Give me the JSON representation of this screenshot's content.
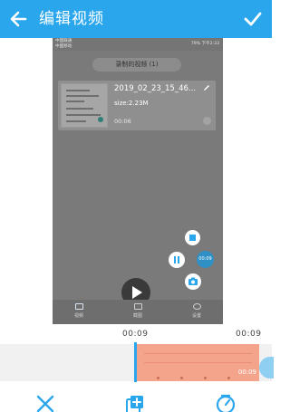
{
  "appbar": {
    "title": "编辑视频",
    "background": "#2aa6ec"
  },
  "preview": {
    "status_bar": {
      "carrier": "中国联通\n中国移动",
      "system": "79% 下午2:33"
    },
    "dropdown_label": "录制的视频 (1)",
    "video_item": {
      "filename": "2019_02_23_15_46...",
      "size": "size:2.23M",
      "duration": "00:06"
    },
    "floating_timer": "00:09",
    "bottom_tabs": [
      {
        "label": "视频",
        "icon": "video-icon"
      },
      {
        "label": "截图",
        "icon": "image-icon"
      },
      {
        "label": "设置",
        "icon": "settings-icon"
      }
    ]
  },
  "timeline": {
    "current_time": "00:09",
    "total_time": "00:09",
    "clip_time": "00:09",
    "clip_color": "#f4a48b",
    "accent": "#2aa6ec"
  },
  "toolbar": {
    "icons": [
      "scissors-icon",
      "add-clip-icon",
      "speed-icon"
    ]
  }
}
